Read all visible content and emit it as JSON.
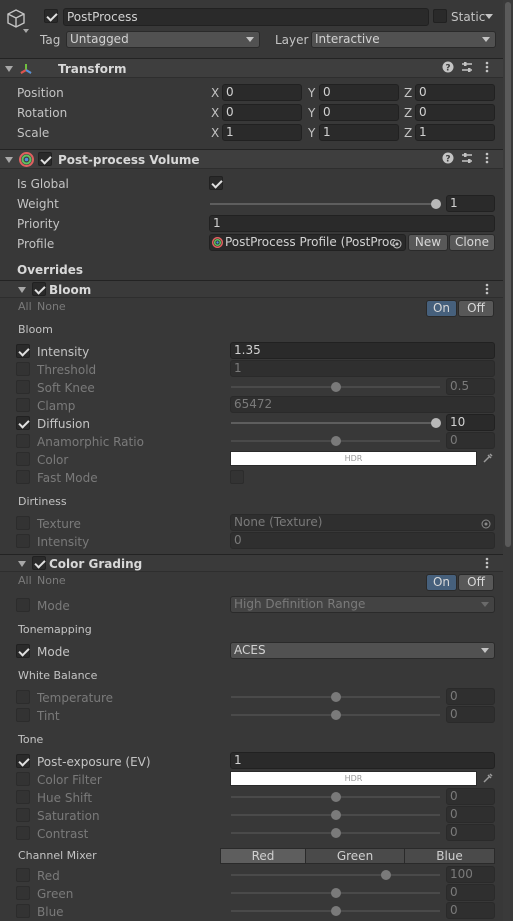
{
  "object": {
    "name": "PostProcess",
    "static_label": "Static",
    "tag_label": "Tag",
    "tag_value": "Untagged",
    "layer_label": "Layer",
    "layer_value": "Interactive"
  },
  "transform": {
    "title": "Transform",
    "rows": [
      {
        "label": "Position",
        "x": "0",
        "y": "0",
        "z": "0"
      },
      {
        "label": "Rotation",
        "x": "0",
        "y": "0",
        "z": "0"
      },
      {
        "label": "Scale",
        "x": "1",
        "y": "1",
        "z": "1"
      }
    ],
    "axis_x": "X",
    "axis_y": "Y",
    "axis_z": "Z"
  },
  "volume": {
    "title": "Post-process Volume",
    "is_global_label": "Is Global",
    "weight_label": "Weight",
    "weight_value": "1",
    "priority_label": "Priority",
    "priority_value": "1",
    "profile_label": "Profile",
    "profile_value": "PostProcess Profile (PostProc",
    "new_label": "New",
    "clone_label": "Clone",
    "overrides_label": "Overrides"
  },
  "bloom": {
    "title": "Bloom",
    "all": "All",
    "none": "None",
    "on": "On",
    "off": "Off",
    "section": "Bloom",
    "intensity_label": "Intensity",
    "intensity_value": "1.35",
    "threshold_label": "Threshold",
    "threshold_value": "1",
    "softknee_label": "Soft Knee",
    "softknee_value": "0.5",
    "clamp_label": "Clamp",
    "clamp_value": "65472",
    "diffusion_label": "Diffusion",
    "diffusion_value": "10",
    "anamorphic_label": "Anamorphic Ratio",
    "anamorphic_value": "0",
    "color_label": "Color",
    "color_hdr": "HDR",
    "fastmode_label": "Fast Mode",
    "dirtiness_section": "Dirtiness",
    "texture_label": "Texture",
    "texture_value": "None (Texture)",
    "dirt_intensity_label": "Intensity",
    "dirt_intensity_value": "0"
  },
  "color_grading": {
    "title": "Color Grading",
    "all": "All",
    "none": "None",
    "on": "On",
    "off": "Off",
    "mode_label": "Mode",
    "mode_value": "High Definition Range",
    "tonemapping_section": "Tonemapping",
    "tm_mode_label": "Mode",
    "tm_mode_value": "ACES",
    "white_balance_section": "White Balance",
    "temperature_label": "Temperature",
    "temperature_value": "0",
    "tint_label": "Tint",
    "tint_value": "0",
    "tone_section": "Tone",
    "post_exposure_label": "Post-exposure (EV)",
    "post_exposure_value": "1",
    "color_filter_label": "Color Filter",
    "color_filter_hdr": "HDR",
    "hue_shift_label": "Hue Shift",
    "hue_shift_value": "0",
    "saturation_label": "Saturation",
    "saturation_value": "0",
    "contrast_label": "Contrast",
    "contrast_value": "0",
    "channel_mixer_section": "Channel Mixer",
    "tab_red": "Red",
    "tab_green": "Green",
    "tab_blue": "Blue",
    "red_label": "Red",
    "red_value": "100",
    "green_label": "Green",
    "green_value": "0",
    "blue_label": "Blue",
    "blue_value": "0"
  },
  "icons": [
    "cube-icon",
    "transform-icon",
    "postprocess-icon",
    "help-icon",
    "settings-icon",
    "menu-icon",
    "eyedropper-icon",
    "object-picker-icon"
  ]
}
